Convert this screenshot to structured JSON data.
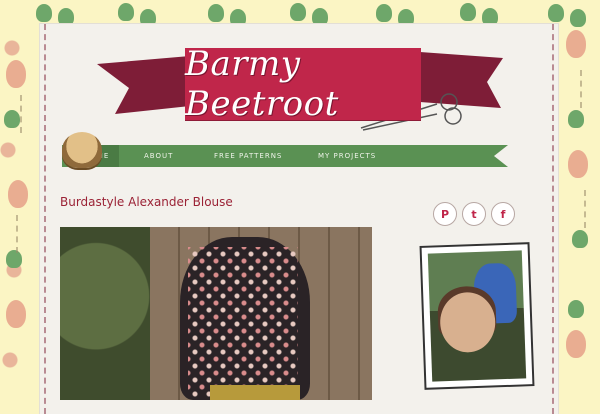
{
  "site": {
    "title": "Barmy Beetroot"
  },
  "nav": {
    "items": [
      "HOME",
      "ABOUT",
      "FREE PATTERNS",
      "MY PROJECTS"
    ]
  },
  "post": {
    "title": "Burdastyle Alexander Blouse"
  },
  "social": {
    "icons": [
      "pinterest-icon",
      "twitter-icon",
      "facebook-icon"
    ]
  },
  "colors": {
    "brand": "#c0264a",
    "nav_green": "#5a9153",
    "paper": "#f3f1ec",
    "background": "#fbf5c4"
  }
}
